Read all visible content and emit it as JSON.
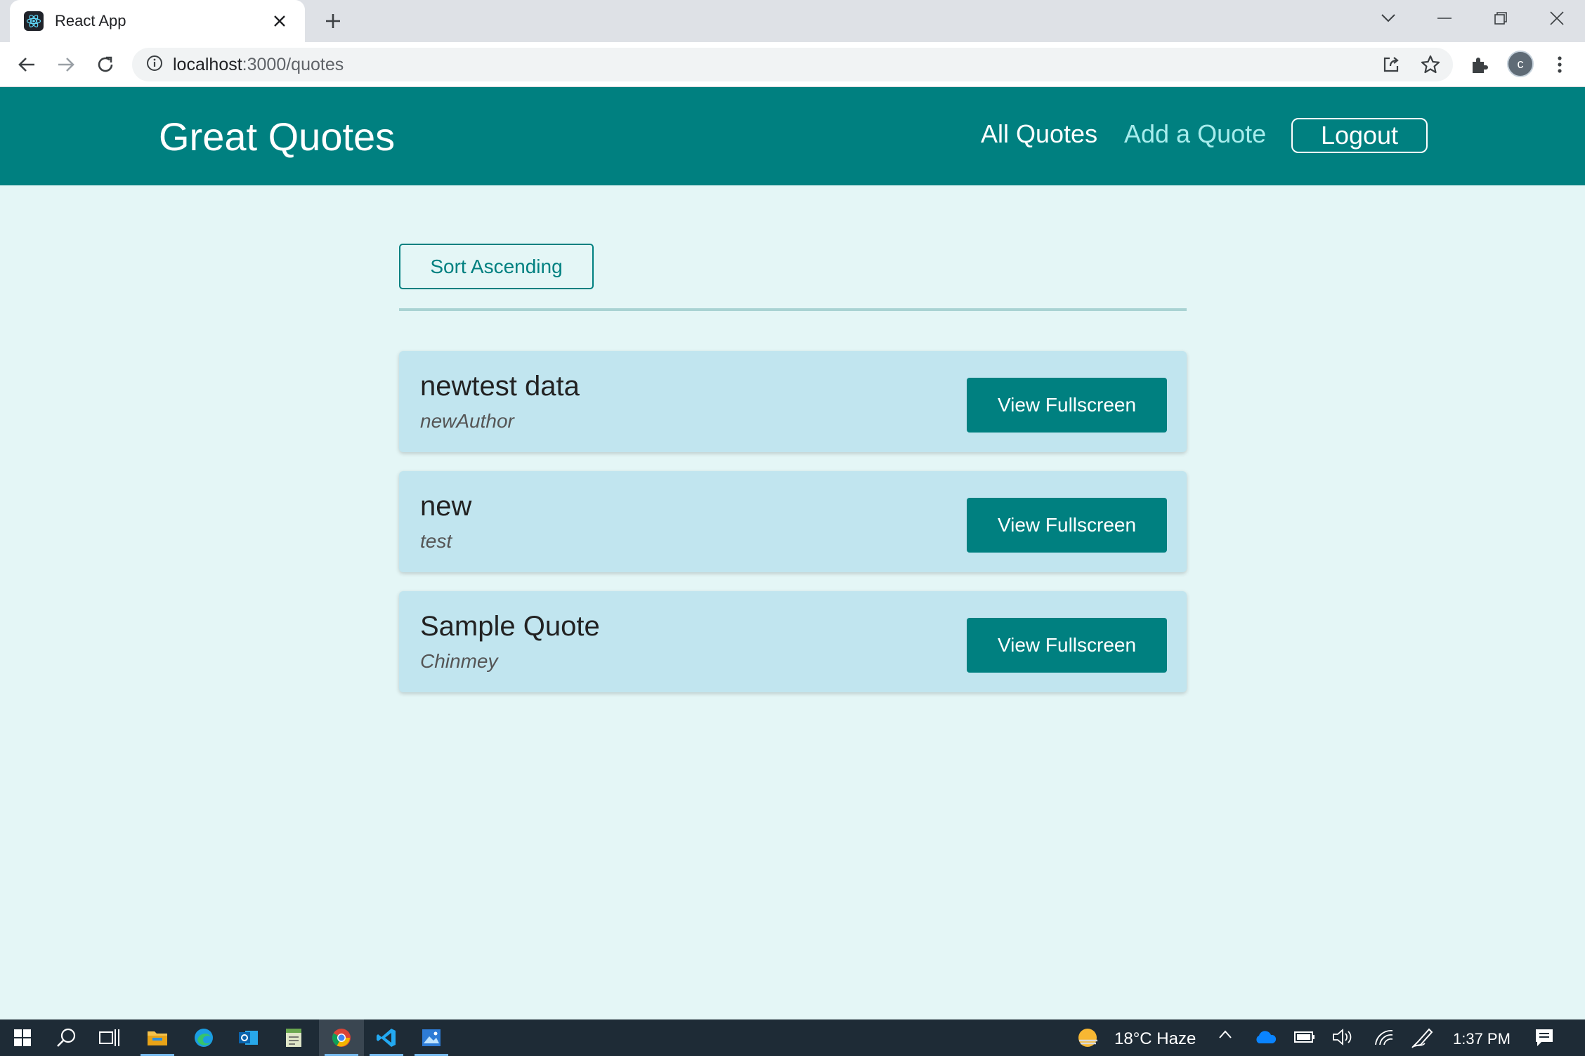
{
  "browser": {
    "tab_title": "React App",
    "new_tab_symbol": "+",
    "close_symbol": "✕",
    "url_host": "localhost",
    "url_path": ":3000/quotes",
    "profile_initial": "c"
  },
  "header": {
    "logo": "Great Quotes",
    "nav_all": "All Quotes",
    "nav_add": "Add a Quote",
    "logout": "Logout"
  },
  "main": {
    "sort_label": "Sort Ascending",
    "quotes": [
      {
        "text": "newtest data",
        "author": "newAuthor",
        "button": "View Fullscreen"
      },
      {
        "text": "new",
        "author": "test",
        "button": "View Fullscreen"
      },
      {
        "text": "Sample Quote",
        "author": "Chinmey",
        "button": "View Fullscreen"
      }
    ]
  },
  "taskbar": {
    "weather": "18°C  Haze",
    "time": "1:37 PM"
  },
  "colors": {
    "header_bg": "#008080",
    "page_bg": "#e4f6f6",
    "card_bg": "#c1e5ef",
    "accent": "#008080",
    "nav_secondary": "#a7ecec"
  }
}
